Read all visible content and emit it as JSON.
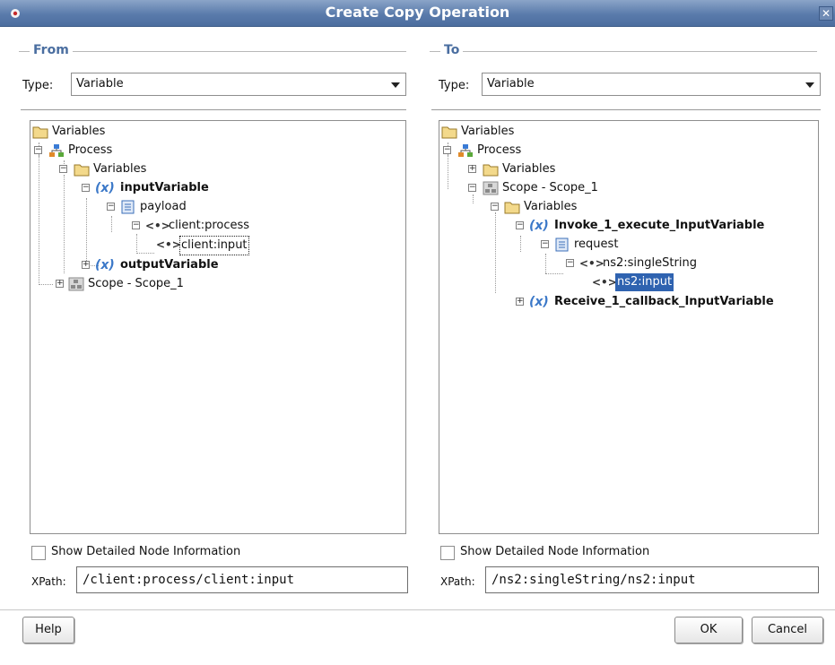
{
  "window": {
    "title": "Create Copy Operation",
    "close_glyph": "✕",
    "app_icon": "duke-icon"
  },
  "from": {
    "group_title": "From",
    "type_label": "Type:",
    "type_value": "Variable",
    "tree": {
      "root": "Variables",
      "process": "Process",
      "variables": "Variables",
      "input_variable": "inputVariable",
      "payload": "payload",
      "client_process": "client:process",
      "client_input": "client:input",
      "output_variable": "outputVariable",
      "scope": "Scope - Scope_1"
    },
    "show_detail_label": "Show Detailed Node Information",
    "xpath_label": "XPath:",
    "xpath_value": "/client:process/client:input"
  },
  "to": {
    "group_title": "To",
    "type_label": "Type:",
    "type_value": "Variable",
    "tree": {
      "root": "Variables",
      "process": "Process",
      "variables": "Variables",
      "scope": "Scope - Scope_1",
      "scope_variables": "Variables",
      "invoke_var": "Invoke_1_execute_InputVariable",
      "request": "request",
      "single_string": "ns2:singleString",
      "ns2_input": "ns2:input",
      "receive_var": "Receive_1_callback_InputVariable"
    },
    "show_detail_label": "Show Detailed Node Information",
    "xpath_label": "XPath:",
    "xpath_value": "/ns2:singleString/ns2:input"
  },
  "buttons": {
    "help": "Help",
    "ok": "OK",
    "cancel": "Cancel"
  },
  "glyphs": {
    "var": "(x)",
    "elem": "<•>",
    "expand": "+",
    "collapse": "−"
  },
  "colors": {
    "title_bar": "#5a7bab",
    "group_title": "#4a6ea0",
    "variable_icon": "#3b78c8",
    "selection": "#2f63b0"
  }
}
